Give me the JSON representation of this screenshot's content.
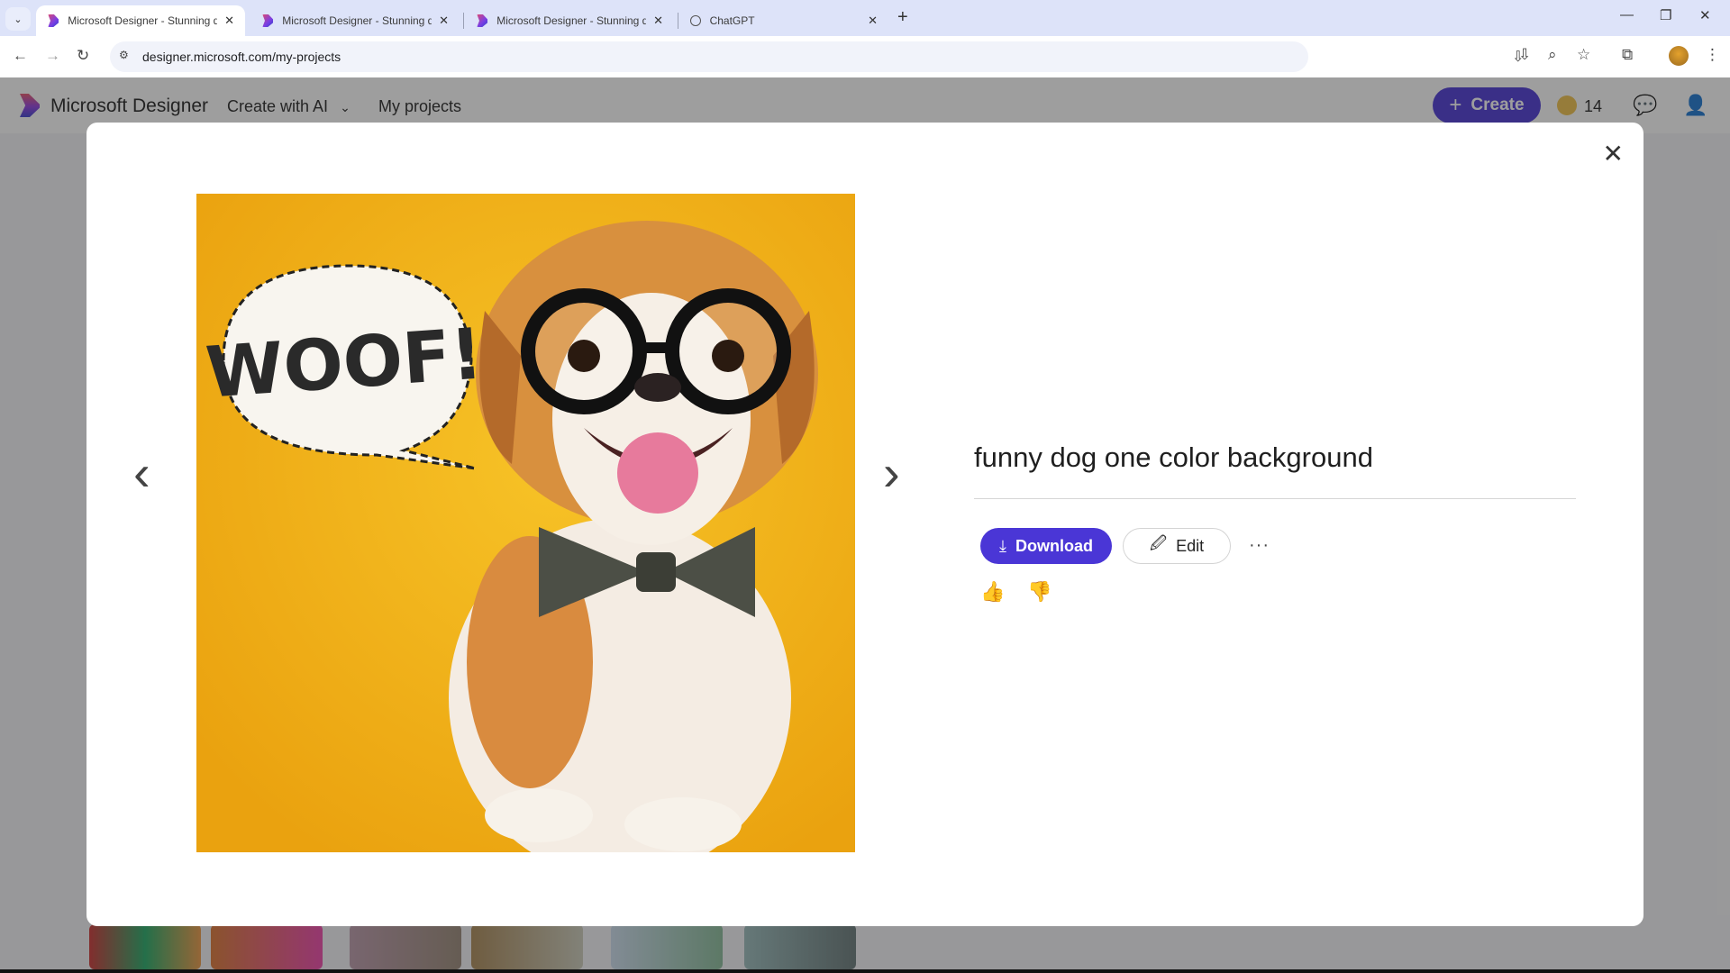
{
  "browser": {
    "tabs": [
      {
        "title": "Microsoft Designer - Stunning designs in a flash",
        "active": true
      },
      {
        "title": "Microsoft Designer - Stunning designs in a flash",
        "active": false
      },
      {
        "title": "Microsoft Designer - Stunning designs in a flash",
        "active": false
      },
      {
        "title": "ChatGPT",
        "active": false
      }
    ],
    "tab_close_glyph": "✕",
    "new_tab_glyph": "+",
    "tab_search_glyph": "⌄",
    "url": "designer.microsoft.com/my-projects",
    "nav": {
      "back": "←",
      "forward": "→",
      "reload": "↻"
    },
    "window": {
      "minimize": "—",
      "restore": "❐",
      "close": "✕"
    },
    "icons": {
      "install": "⇩",
      "zoom": "⌕",
      "bookmark": "☆",
      "extensions": "⧉",
      "menu": "⋮",
      "site_info": "⚙"
    }
  },
  "app": {
    "brand": "Microsoft Designer",
    "nav": {
      "create_with_ai": "Create with AI",
      "chevron": "⌄",
      "my_projects": "My projects"
    },
    "create_button": {
      "icon": "+",
      "label": "Create"
    },
    "credits": "14",
    "icons": {
      "feedback": "💬",
      "account": "👤"
    }
  },
  "modal": {
    "close_glyph": "✕",
    "prev_glyph": "‹",
    "next_glyph": "›",
    "image_alt": "Puppy with round glasses and bow tie on yellow background with WOOF! speech bubble",
    "speech_bubble_text": "WOOF!",
    "prompt": "funny dog one color background",
    "download": {
      "icon": "⤓",
      "label": "Download"
    },
    "edit": {
      "icon": "🖉",
      "label": "Edit"
    },
    "more": "···",
    "like": "👍",
    "dislike": "👎"
  },
  "colors": {
    "accent": "#4a36d6",
    "image_bg": "#f2b21b"
  }
}
